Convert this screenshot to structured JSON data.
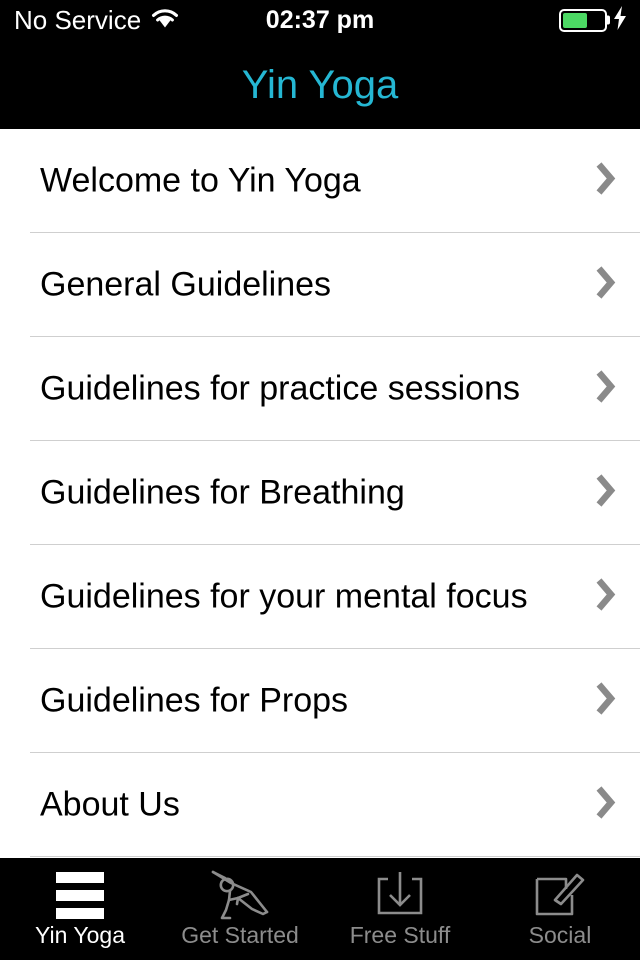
{
  "status_bar": {
    "carrier": "No Service",
    "wifi_icon": "wifi-icon",
    "time": "02:37 pm",
    "battery_icon": "battery-icon",
    "battery_percent": 55,
    "charging_icon": "lightning-bolt-icon"
  },
  "nav": {
    "title": "Yin Yoga",
    "title_color": "#25B7D3"
  },
  "list": {
    "rows": [
      {
        "label": "Welcome to Yin Yoga",
        "accessory_icon": "chevron-right-icon"
      },
      {
        "label": "General Guidelines",
        "accessory_icon": "chevron-right-icon"
      },
      {
        "label": "Guidelines for practice sessions",
        "accessory_icon": "chevron-right-icon"
      },
      {
        "label": "Guidelines for Breathing",
        "accessory_icon": "chevron-right-icon"
      },
      {
        "label": "Guidelines for your mental focus",
        "accessory_icon": "chevron-right-icon"
      },
      {
        "label": "Guidelines for Props",
        "accessory_icon": "chevron-right-icon"
      },
      {
        "label": "About Us",
        "accessory_icon": "chevron-right-icon"
      }
    ]
  },
  "tabbar": {
    "active_index": 0,
    "active_color": "#ffffff",
    "inactive_color": "#8c8c8c",
    "tabs": [
      {
        "label": "Yin Yoga",
        "icon": "hamburger-menu-icon"
      },
      {
        "label": "Get Started",
        "icon": "yoga-pose-icon"
      },
      {
        "label": "Free Stuff",
        "icon": "download-box-icon"
      },
      {
        "label": "Social",
        "icon": "compose-pencil-icon"
      }
    ]
  }
}
